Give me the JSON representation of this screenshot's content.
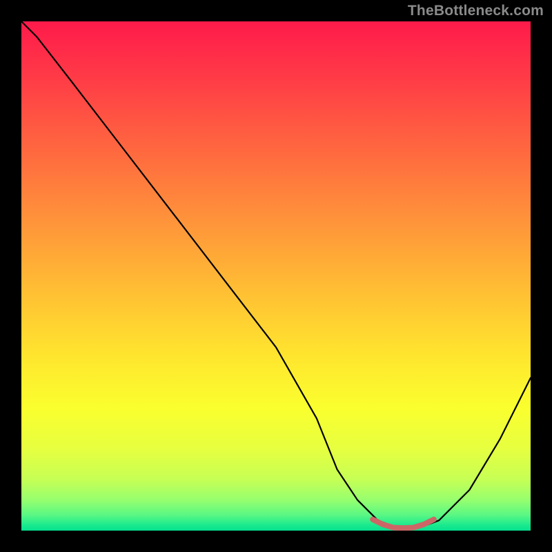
{
  "watermark": "TheBottleneck.com",
  "chart_data": {
    "type": "line",
    "title": "",
    "xlabel": "",
    "ylabel": "",
    "xlim": [
      0,
      100
    ],
    "ylim": [
      0,
      100
    ],
    "series": [
      {
        "name": "bottleneck-curve",
        "x": [
          0,
          3,
          10,
          20,
          30,
          40,
          50,
          58,
          62,
          66,
          70,
          74,
          78,
          82,
          88,
          94,
          100
        ],
        "values": [
          100,
          97,
          88,
          75,
          62,
          49,
          36,
          22,
          12,
          6,
          2,
          0.5,
          0.5,
          2,
          8,
          18,
          30
        ]
      },
      {
        "name": "optimal-range-marker",
        "x": [
          69,
          71,
          73,
          75,
          77,
          79,
          81
        ],
        "values": [
          2.2,
          1.2,
          0.6,
          0.5,
          0.6,
          1.2,
          2.2
        ]
      }
    ],
    "annotations": [],
    "grid": false,
    "legend": false,
    "colors": {
      "curve": "#000000",
      "marker": "#cc6666",
      "gradient_top": "#ff1a4b",
      "gradient_bottom": "#06e18f"
    }
  }
}
